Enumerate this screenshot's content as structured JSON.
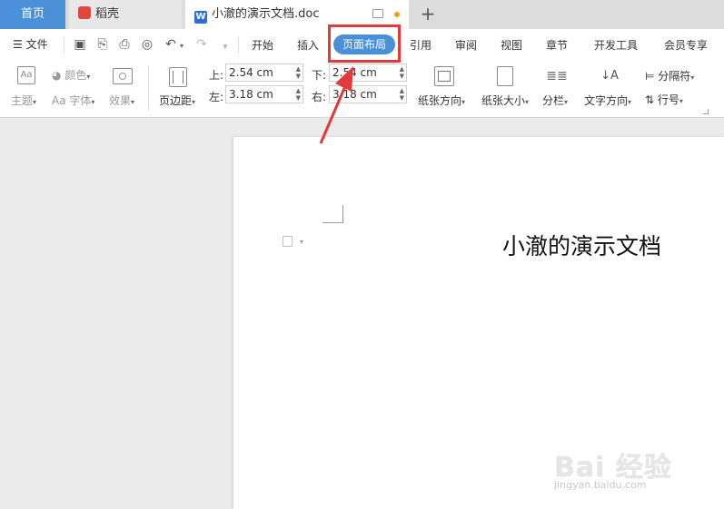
{
  "tabs": {
    "home": "首页",
    "daoke": "稻壳",
    "doc_title": "小澈的演示文档.doc",
    "new_tab": "+"
  },
  "menubar": {
    "file": "文件",
    "tabs": [
      "开始",
      "插入",
      "页面布局",
      "引用",
      "审阅",
      "视图",
      "章节",
      "开发工具",
      "会员专享"
    ]
  },
  "ribbon": {
    "theme": "主题",
    "color": "颜色",
    "font": "字体",
    "effect": "效果",
    "margins": "页边距",
    "top_label": "上:",
    "top_value": "2.54 cm",
    "bottom_label": "下:",
    "bottom_value": "2.54 cm",
    "left_label": "左:",
    "left_value": "3.18 cm",
    "right_label": "右:",
    "right_value": "3.18 cm",
    "orientation": "纸张方向",
    "size": "纸张大小",
    "columns": "分栏",
    "text_direction": "文字方向",
    "breaks": "分隔符",
    "line_numbers": "行号"
  },
  "document": {
    "title": "小澈的演示文档"
  },
  "watermark": {
    "main": "Bai 经验",
    "url": "jingyan.baidu.com"
  },
  "colors": {
    "accent": "#4a90d9",
    "highlight": "#e23a3a"
  }
}
